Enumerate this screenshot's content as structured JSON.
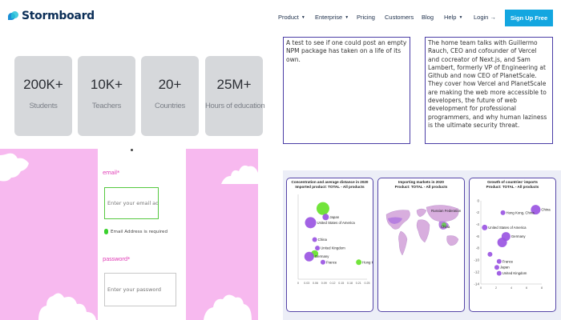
{
  "brand": {
    "name": "Stormboard"
  },
  "nav": {
    "items": [
      {
        "label": "Product",
        "caret": "▼"
      },
      {
        "label": "Enterprise",
        "caret": "▼"
      },
      {
        "label": "Pricing",
        "caret": ""
      },
      {
        "label": "Customers",
        "caret": ""
      },
      {
        "label": "Blog",
        "caret": ""
      },
      {
        "label": "Help",
        "caret": "▼"
      },
      {
        "label": "Login →",
        "caret": ""
      }
    ],
    "signup_label": "Sign Up Free",
    "accent": "#13a6e0"
  },
  "stats": [
    {
      "value": "200K+",
      "label": "Students"
    },
    {
      "value": "10K+",
      "label": "Teachers"
    },
    {
      "value": "20+",
      "label": "Countries"
    },
    {
      "value": "25M+",
      "label": "Hours of education"
    }
  ],
  "form": {
    "email_label": "email",
    "email_placeholder": "Enter your email address",
    "email_hint": "Email Address is required",
    "password_label": "password",
    "password_placeholder": "Enter your password",
    "pink": "#f7b9ef",
    "label_color": "#e03fb7"
  },
  "text_cards": [
    {
      "text": "A test to see if one could post an empty NPM package has taken on a life of its own."
    },
    {
      "text": "The home team talks with Guillermo Rauch, CEO and cofounder of Vercel and cocreator of Next.js, and Sam Lambert, formerly VP of Engineering at Github and now CEO of PlanetScale. They cover how Vercel and PlanetScale are making the web more accessible to developers, the future of web development for professional programmers, and why human laziness is the ultimate security threat."
    }
  ],
  "chart_data": [
    {
      "type": "scatter",
      "title": "Concentration and average distance in 2020\nImported product: TOTAL - All products",
      "xlim": [
        0,
        0.25
      ],
      "ylim": [
        0,
        30
      ],
      "xticks": [
        "0",
        "0.03",
        "0.06",
        "0.09",
        "0.12",
        "0.15",
        "0.18",
        "0.21",
        "0.25"
      ],
      "points": [
        {
          "label": "",
          "x": 0.09,
          "y": 25,
          "r": 8,
          "color": "#66e22a"
        },
        {
          "label": "Japan",
          "x": 0.1,
          "y": 22,
          "r": 4,
          "color": "#9a55e2"
        },
        {
          "label": "United States of America",
          "x": 0.045,
          "y": 20,
          "r": 7,
          "color": "#9a55e2"
        },
        {
          "label": "China",
          "x": 0.06,
          "y": 14,
          "r": 3,
          "color": "#9a55e2"
        },
        {
          "label": "United Kingdom",
          "x": 0.07,
          "y": 11,
          "r": 3,
          "color": "#9a55e2"
        },
        {
          "label": "",
          "x": 0.06,
          "y": 9,
          "r": 4.5,
          "color": "#66e22a"
        },
        {
          "label": "Germany",
          "x": 0.04,
          "y": 8,
          "r": 6,
          "color": "#9a55e2"
        },
        {
          "label": "France",
          "x": 0.09,
          "y": 6,
          "r": 3,
          "color": "#9a55e2"
        },
        {
          "label": "Hong Kong, China",
          "x": 0.22,
          "y": 6,
          "r": 3.5,
          "color": "#66e22a"
        }
      ]
    },
    {
      "type": "map",
      "title": "Importing markets in 2020\nProduct: TOTAL - All products",
      "labels": [
        "Russian Federation",
        "China"
      ],
      "colors": {
        "land": "#d8aede",
        "highlight": "#b780e0",
        "green": "#5bd63f"
      }
    },
    {
      "type": "scatter",
      "title": "Growth of countries' imports\nProduct: TOTAL - All products",
      "xlim": [
        0,
        8
      ],
      "ylim": [
        -14,
        0
      ],
      "xticks": [
        "0",
        "2",
        "4",
        "6",
        "8"
      ],
      "yticks": [
        "0",
        "-2",
        "-4",
        "-6",
        "-8",
        "-10",
        "-12",
        "-14"
      ],
      "points": [
        {
          "label": "China",
          "x": 7.2,
          "y": -1.5,
          "r": 6,
          "color": "#9a55e2"
        },
        {
          "label": "Hong Kong, China",
          "x": 2.9,
          "y": -2,
          "r": 3,
          "color": "#9a55e2"
        },
        {
          "label": "United States of America",
          "x": 0.5,
          "y": -4.5,
          "r": 3.5,
          "color": "#9a55e2"
        },
        {
          "label": "Germany",
          "x": 3.3,
          "y": -6,
          "r": 5.5,
          "color": "#9a55e2"
        },
        {
          "label": "",
          "x": 2.8,
          "y": -7,
          "r": 6,
          "color": "#9a55e2"
        },
        {
          "label": "",
          "x": 1.2,
          "y": -9,
          "r": 3,
          "color": "#9a55e2"
        },
        {
          "label": "France",
          "x": 2.4,
          "y": -10.2,
          "r": 3,
          "color": "#9a55e2"
        },
        {
          "label": "Japan",
          "x": 2.1,
          "y": -11.2,
          "r": 3,
          "color": "#9a55e2"
        },
        {
          "label": "United Kingdom",
          "x": 2.4,
          "y": -12.2,
          "r": 3,
          "color": "#9a55e2"
        }
      ]
    }
  ]
}
